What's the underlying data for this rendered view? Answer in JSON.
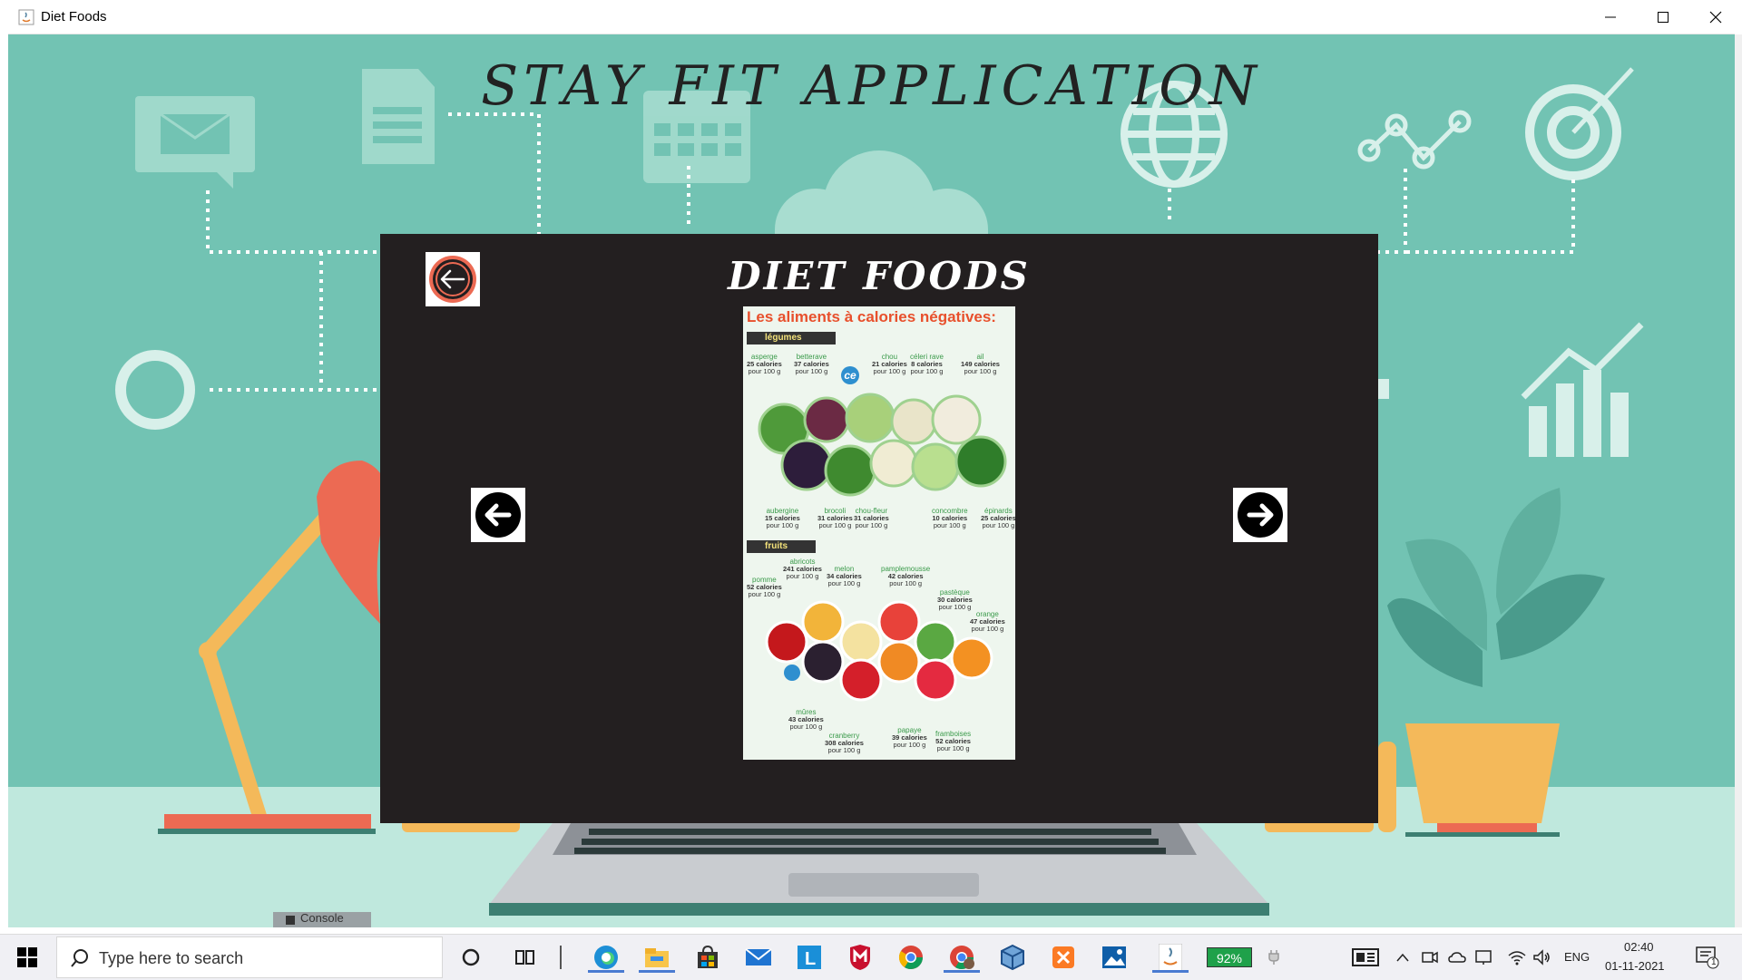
{
  "window": {
    "title": "Diet Foods",
    "controls": [
      "minimize",
      "maximize",
      "close"
    ]
  },
  "app": {
    "heading": "STAY FIT APPLICATION",
    "panel_title": "DIET FOODS",
    "back_button_icon": "arrow-left-circle-icon",
    "prev_button_icon": "arrow-left-icon",
    "next_button_icon": "arrow-right-icon"
  },
  "poster": {
    "title": "Les aliments à calories négatives:",
    "section_vegetables": "légumes",
    "section_fruits": "fruits",
    "logo_text": "ce",
    "vegetables_top": [
      {
        "name": "asperge",
        "cal": "25 calories",
        "unit": "pour 100 g"
      },
      {
        "name": "betterave",
        "cal": "37 calories",
        "unit": "pour 100 g"
      },
      {
        "name": "chou",
        "cal": "21 calories",
        "unit": "pour 100 g"
      },
      {
        "name": "céleri rave",
        "cal": "8 calories",
        "unit": "pour 100 g"
      },
      {
        "name": "ail",
        "cal": "149 calories",
        "unit": "pour 100 g"
      }
    ],
    "vegetables_bottom": [
      {
        "name": "aubergine",
        "cal": "15 calories",
        "unit": "pour 100 g"
      },
      {
        "name": "brocoli",
        "cal": "31 calories",
        "unit": "pour 100 g"
      },
      {
        "name": "chou-fleur",
        "cal": "31 calories",
        "unit": "pour 100 g"
      },
      {
        "name": "concombre",
        "cal": "10 calories",
        "unit": "pour 100 g"
      },
      {
        "name": "épinards",
        "cal": "25 calories",
        "unit": "pour 100 g"
      }
    ],
    "fruits": [
      {
        "name": "abricots",
        "cal": "241 calories",
        "unit": "pour 100 g"
      },
      {
        "name": "melon",
        "cal": "34 calories",
        "unit": "pour 100 g"
      },
      {
        "name": "pamplemousse",
        "cal": "42 calories",
        "unit": "pour 100 g"
      },
      {
        "name": "pomme",
        "cal": "52 calories",
        "unit": "pour 100 g"
      },
      {
        "name": "pastèque",
        "cal": "30 calories",
        "unit": "pour 100 g"
      },
      {
        "name": "orange",
        "cal": "47 calories",
        "unit": "pour 100 g"
      },
      {
        "name": "mûres",
        "cal": "43 calories",
        "unit": "pour 100 g"
      },
      {
        "name": "cranberry",
        "cal": "308 calories",
        "unit": "pour 100 g"
      },
      {
        "name": "papaye",
        "cal": "39 calories",
        "unit": "pour 100 g"
      },
      {
        "name": "framboises",
        "cal": "52 calories",
        "unit": "pour 100 g"
      }
    ]
  },
  "background_fragment": "Console",
  "taskbar": {
    "search_placeholder": "Type here to search",
    "battery": "92%",
    "language": "ENG",
    "time": "02:40",
    "date": "01-11-2021",
    "notifications": "1",
    "icons": [
      "cortana-icon",
      "task-view-icon",
      "edge-icon",
      "file-explorer-icon",
      "store-icon",
      "mail-icon",
      "l-app-icon",
      "mcafee-icon",
      "chrome-icon",
      "chrome-profile-icon",
      "virtualbox-icon",
      "xampp-icon",
      "photos-icon",
      "java-icon"
    ]
  },
  "colors": {
    "background": "#72c3b3",
    "panel": "#231f20",
    "poster_title": "#e8502c",
    "accent_salmon": "#ec6a53",
    "lamp_yellow": "#f4b95a"
  }
}
